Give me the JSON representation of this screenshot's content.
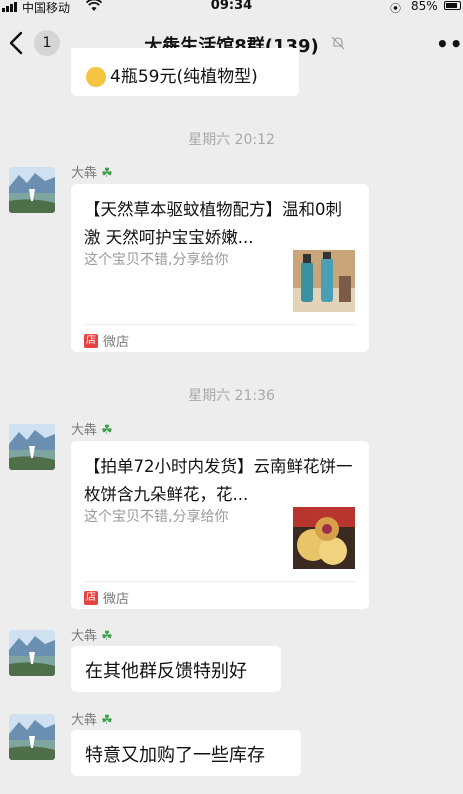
{
  "status_bar": {
    "carrier": "中国移动",
    "time": "09:34",
    "battery": "85%",
    "battery_level": 0.85
  },
  "nav": {
    "unread_count": "1",
    "title": "大犇生活馆8群(139)"
  },
  "previous_message": {
    "text": "4瓶59元(纯植物型)"
  },
  "messages": [
    {
      "timestamp": "星期六 20:12",
      "sender": "大犇",
      "card": {
        "title": "【天然草本驱蚊植物配方】温和0刺激 天然呵护宝宝娇嫩...",
        "desc": "这个宝贝不错,分享给你",
        "source": "微店",
        "source_icon": "店"
      }
    },
    {
      "timestamp": "星期六 21:36",
      "sender": "大犇",
      "card": {
        "title": "【拍单72小时内发货】云南鲜花饼一枚饼含九朵鲜花，花...",
        "desc": "这个宝贝不错,分享给你",
        "source": "微店",
        "source_icon": "店"
      }
    },
    {
      "sender": "大犇",
      "text": "在其他群反馈特别好"
    },
    {
      "sender": "大犇",
      "text": "特意又加购了一些库存"
    }
  ],
  "colors": {
    "background": "#ededed",
    "bubble": "#ffffff",
    "weidian_red": "#e64340",
    "clover_green": "#3aa04a"
  }
}
